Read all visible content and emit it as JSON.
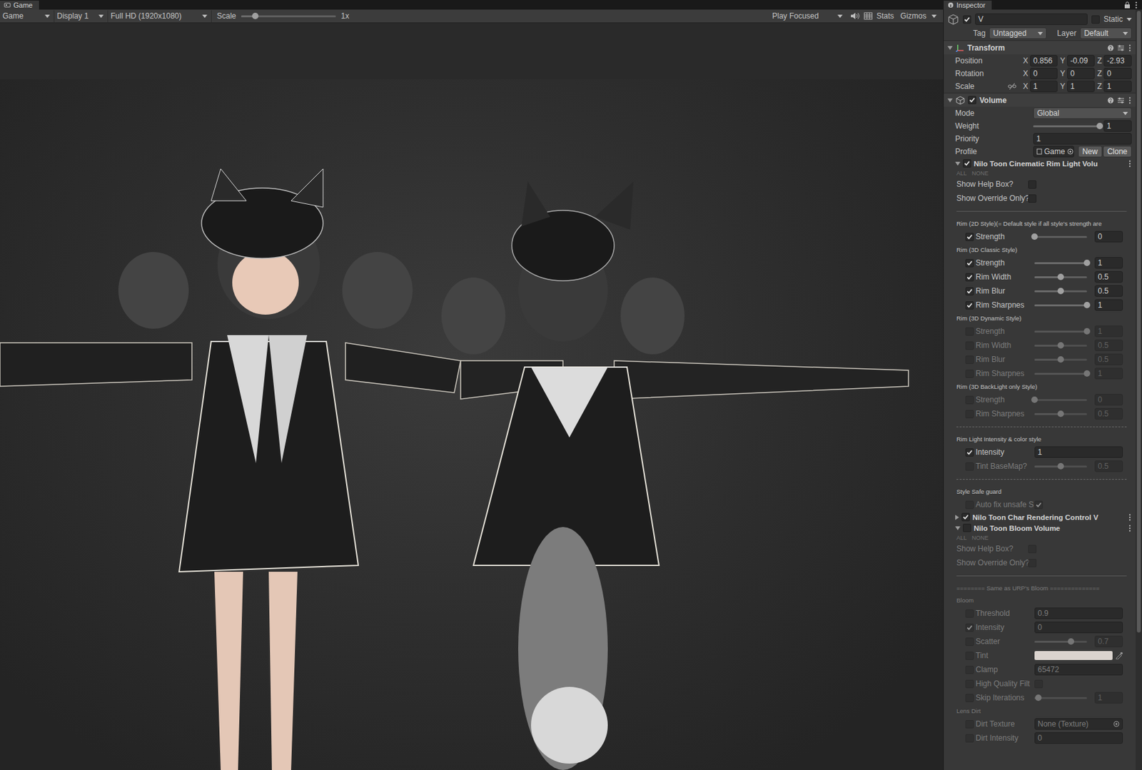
{
  "game": {
    "tab": "Game",
    "toolbar": {
      "view": "Game",
      "display": "Display 1",
      "resolution": "Full HD (1920x1080)",
      "scale_label": "Scale",
      "scale_level": 0.15,
      "scale_value": "1x",
      "play_mode": "Play Focused",
      "muted": false,
      "stats": "Stats",
      "gizmos": "Gizmos"
    }
  },
  "inspector": {
    "tab": "Inspector",
    "object": {
      "active": true,
      "name": "V",
      "static_label": "Static",
      "static": false,
      "tag_label": "Tag",
      "tag": "Untagged",
      "layer_label": "Layer",
      "layer": "Default"
    },
    "transform": {
      "title": "Transform",
      "expanded": true,
      "rows": [
        {
          "label": "Position",
          "constrain_icon": false,
          "axes": [
            {
              "axis": "X",
              "value": "0.856"
            },
            {
              "axis": "Y",
              "value": "-0.09"
            },
            {
              "axis": "Z",
              "value": "-2.93"
            }
          ]
        },
        {
          "label": "Rotation",
          "constrain_icon": false,
          "axes": [
            {
              "axis": "X",
              "value": "0"
            },
            {
              "axis": "Y",
              "value": "0"
            },
            {
              "axis": "Z",
              "value": "0"
            }
          ]
        },
        {
          "label": "Scale",
          "constrain_icon": true,
          "axes": [
            {
              "axis": "X",
              "value": "1"
            },
            {
              "axis": "Y",
              "value": "1"
            },
            {
              "axis": "Z",
              "value": "1"
            }
          ]
        }
      ]
    },
    "volume": {
      "title": "Volume",
      "enabled": true,
      "expanded": true,
      "mode_label": "Mode",
      "mode": "Global",
      "weight_label": "Weight",
      "weight_level": 1,
      "weight": "1",
      "priority_label": "Priority",
      "priority": "1",
      "profile_label": "Profile",
      "profile": "Game",
      "new": "New",
      "clone": "Clone"
    },
    "overrides": [
      {
        "title": "Nilo Toon Cinematic Rim Light Volu",
        "enabled": true,
        "expanded": true,
        "rows": [
          {
            "kind": "allnone",
            "all": "ALL",
            "none": "NONE"
          },
          {
            "kind": "toggle",
            "label": "Show Help Box?",
            "checked": false
          },
          {
            "kind": "toggle",
            "label": "Show Override Only?",
            "checked": false
          },
          {
            "kind": "rule"
          },
          {
            "kind": "section",
            "label": "Rim (2D Style)(= Default style if all style's strength are"
          },
          {
            "kind": "slider",
            "label": "Strength",
            "override": true,
            "level": 0,
            "value": "0"
          },
          {
            "kind": "section",
            "label": "Rim (3D Classic Style)"
          },
          {
            "kind": "slider",
            "label": "Strength",
            "override": true,
            "level": 1,
            "value": "1"
          },
          {
            "kind": "slider",
            "label": "Rim Width",
            "override": true,
            "level": 0.5,
            "value": "0.5"
          },
          {
            "kind": "slider",
            "label": "Rim Blur",
            "override": true,
            "level": 0.5,
            "value": "0.5"
          },
          {
            "kind": "slider",
            "label": "Rim Sharpnes",
            "override": true,
            "level": 1,
            "value": "1"
          },
          {
            "kind": "section",
            "label": "Rim (3D Dynamic Style)"
          },
          {
            "kind": "slider",
            "label": "Strength",
            "override": false,
            "level": 1,
            "value": "1"
          },
          {
            "kind": "slider",
            "label": "Rim Width",
            "override": false,
            "level": 0.5,
            "value": "0.5"
          },
          {
            "kind": "slider",
            "label": "Rim Blur",
            "override": false,
            "level": 0.5,
            "value": "0.5"
          },
          {
            "kind": "slider",
            "label": "Rim Sharpnes",
            "override": false,
            "level": 1,
            "value": "1"
          },
          {
            "kind": "section",
            "label": "Rim (3D BackLight only Style)"
          },
          {
            "kind": "slider",
            "label": "Strength",
            "override": false,
            "level": 0,
            "value": "0"
          },
          {
            "kind": "slider",
            "label": "Rim Sharpnes",
            "override": false,
            "level": 0.5,
            "value": "0.5"
          },
          {
            "kind": "dashed-rule"
          },
          {
            "kind": "section",
            "label": "Rim Light Intensity & color style"
          },
          {
            "kind": "field",
            "label": "Intensity",
            "override": true,
            "value": "1"
          },
          {
            "kind": "slider",
            "label": "Tint BaseMap?",
            "override": false,
            "level": 0.5,
            "value": "0.5"
          },
          {
            "kind": "dashed-rule"
          },
          {
            "kind": "section",
            "label": "Style Safe guard"
          },
          {
            "kind": "check",
            "label": "Auto fix unsafe S",
            "override": false,
            "checked": true
          }
        ]
      },
      {
        "title": "Nilo Toon Char Rendering Control V",
        "enabled": true,
        "expanded": false,
        "rows": []
      },
      {
        "title": "Nilo Toon Bloom Volume",
        "enabled": false,
        "expanded": true,
        "rows": [
          {
            "kind": "allnone",
            "all": "ALL",
            "none": "NONE"
          },
          {
            "kind": "toggle",
            "label": "Show Help Box?",
            "checked": false
          },
          {
            "kind": "toggle",
            "label": "Show Override Only?",
            "checked": false
          },
          {
            "kind": "rule"
          },
          {
            "kind": "section",
            "label": "======== Same as URP's Bloom =============="
          },
          {
            "kind": "section",
            "label": "Bloom"
          },
          {
            "kind": "field",
            "label": "Threshold",
            "override": false,
            "value": "0.9"
          },
          {
            "kind": "field",
            "label": "Intensity",
            "override": true,
            "value": "0"
          },
          {
            "kind": "slider",
            "label": "Scatter",
            "override": false,
            "level": 0.7,
            "value": "0.7"
          },
          {
            "kind": "color",
            "label": "Tint",
            "override": false,
            "color": "#f7eee9"
          },
          {
            "kind": "field",
            "label": "Clamp",
            "override": false,
            "value": "65472"
          },
          {
            "kind": "check",
            "label": "High Quality Filt",
            "override": false,
            "checked": false
          },
          {
            "kind": "slider",
            "label": "Skip Iterations",
            "override": false,
            "level": 0.07,
            "value": "1"
          },
          {
            "kind": "section",
            "label": "Lens Dirt"
          },
          {
            "kind": "object",
            "label": "Dirt Texture",
            "override": false,
            "value": "None (Texture)"
          },
          {
            "kind": "field",
            "label": "Dirt Intensity",
            "override": false,
            "value": "0"
          }
        ]
      }
    ]
  }
}
